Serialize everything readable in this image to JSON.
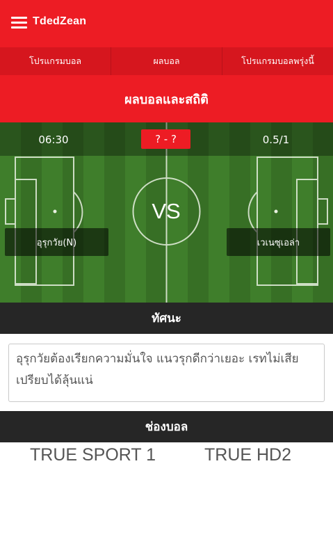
{
  "header": {
    "brand": "TdedZean"
  },
  "nav": {
    "items": [
      "โปรแกรมบอล",
      "ผลบอล",
      "โปรแกรมบอลพรุ่งนี้"
    ]
  },
  "page": {
    "title": "ผลบอลและสถิติ"
  },
  "match": {
    "kickoff": "06:30",
    "score": "? - ?",
    "odds": "0.5/1",
    "vs": "VS",
    "home_team": "อุรุกวัย(N)",
    "away_team": "เวเนซุเอล่า"
  },
  "analysis": {
    "heading": "ทัศนะ",
    "text": "อุรุกวัยต้องเรียกความมั่นใจ แนวรุกดีกว่าเยอะ เรทไม่เสียเปรียบได้ลุ้นแน่"
  },
  "channels": {
    "heading": "ช่องบอล",
    "items": [
      "TRUE SPORT 1",
      "TRUE HD2"
    ]
  },
  "colors": {
    "brand_red": "#ed1c24",
    "dark_bar": "#262626",
    "pitch_green": "#3d7a2a"
  }
}
